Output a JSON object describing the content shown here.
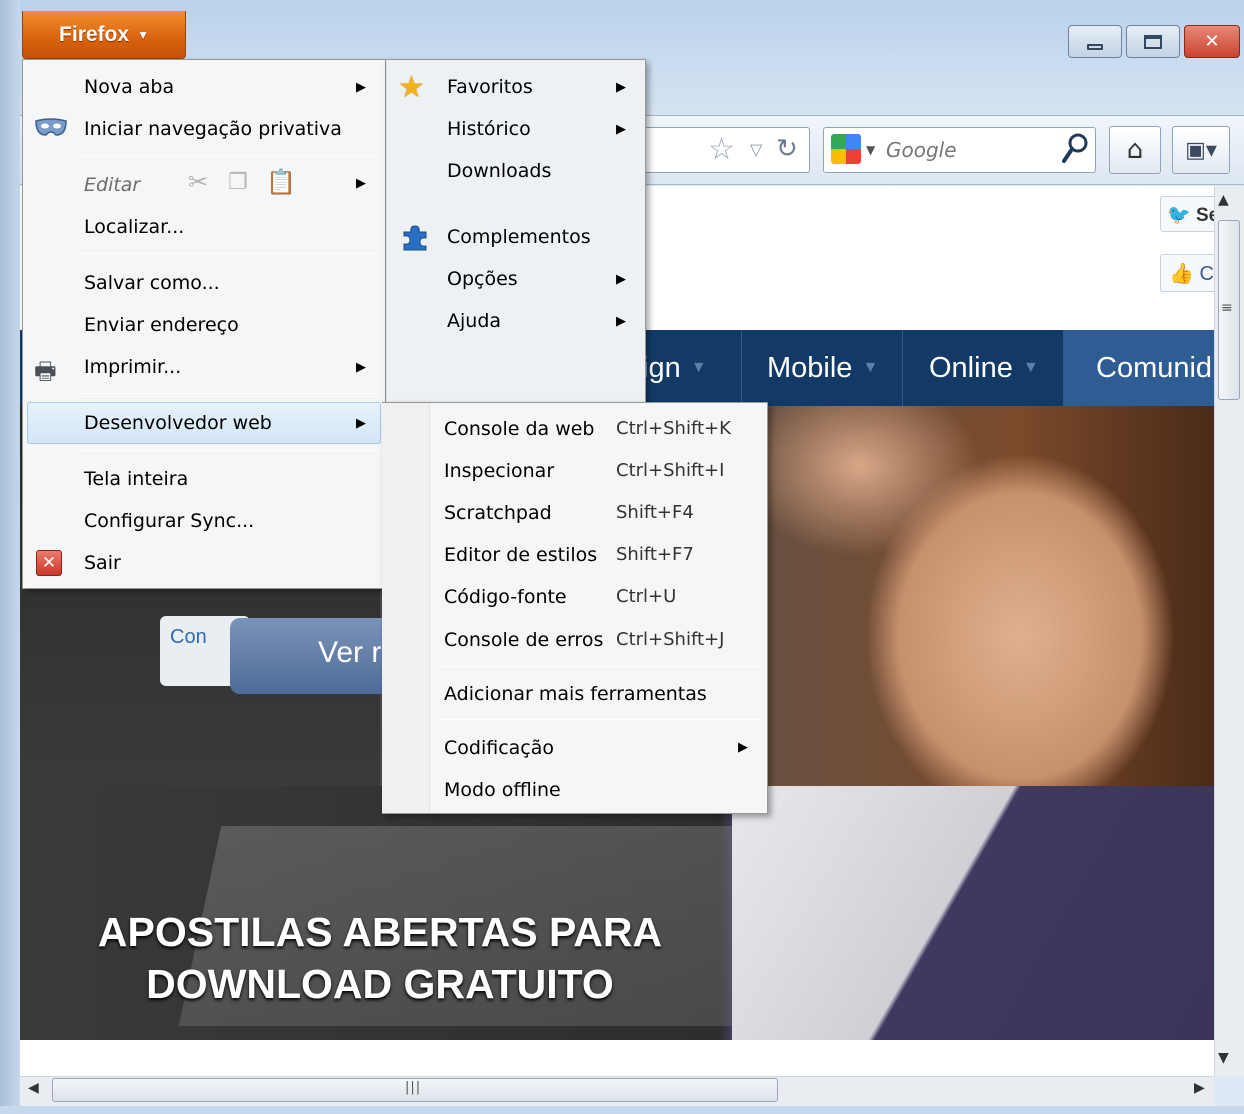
{
  "browser": {
    "app_button_label": "Firefox",
    "search_placeholder": "Google",
    "window_controls": {
      "close_glyph": "✕"
    }
  },
  "app_menu": {
    "left": [
      {
        "label": "Nova aba"
      },
      {
        "label": "Iniciar navegação privativa"
      },
      {
        "label": "Editar"
      },
      {
        "label": "Localizar..."
      },
      {
        "label": "Salvar como..."
      },
      {
        "label": "Enviar endereço"
      },
      {
        "label": "Imprimir..."
      },
      {
        "label": "Desenvolvedor web"
      },
      {
        "label": "Tela inteira"
      },
      {
        "label": "Configurar Sync..."
      },
      {
        "label": "Sair"
      }
    ],
    "right": [
      {
        "label": "Favoritos"
      },
      {
        "label": "Histórico"
      },
      {
        "label": "Downloads"
      },
      {
        "label": "Complementos"
      },
      {
        "label": "Opções"
      },
      {
        "label": "Ajuda"
      }
    ]
  },
  "dev_submenu": {
    "items": [
      {
        "label": "Console da web",
        "shortcut": "Ctrl+Shift+K"
      },
      {
        "label": "Inspecionar",
        "shortcut": "Ctrl+Shift+I"
      },
      {
        "label": "Scratchpad",
        "shortcut": "Shift+F4"
      },
      {
        "label": "Editor de estilos",
        "shortcut": "Shift+F7"
      },
      {
        "label": "Código-fonte",
        "shortcut": "Ctrl+U"
      },
      {
        "label": "Console de erros",
        "shortcut": "Ctrl+Shift+J"
      },
      {
        "label": "Adicionar mais ferramentas"
      },
      {
        "label": "Codificação"
      },
      {
        "label": "Modo offline"
      }
    ]
  },
  "page": {
    "social": {
      "twitter_label": "Se",
      "facebook_label": "C"
    },
    "nav": [
      {
        "label": "ign"
      },
      {
        "label": "Mobile"
      },
      {
        "label": "Online"
      },
      {
        "label": "Comunid"
      }
    ],
    "hero_badge": "Con",
    "hero_button": "Ver r",
    "banner_line1": "APOSTILAS ABERTAS PARA",
    "banner_line2": "DOWNLOAD GRATUITO"
  },
  "colors": {
    "firefox_orange": "#e0701a",
    "nav_blue": "#133a66",
    "menu_bg": "#f5f6f7",
    "highlight": "#d3e6f7"
  }
}
